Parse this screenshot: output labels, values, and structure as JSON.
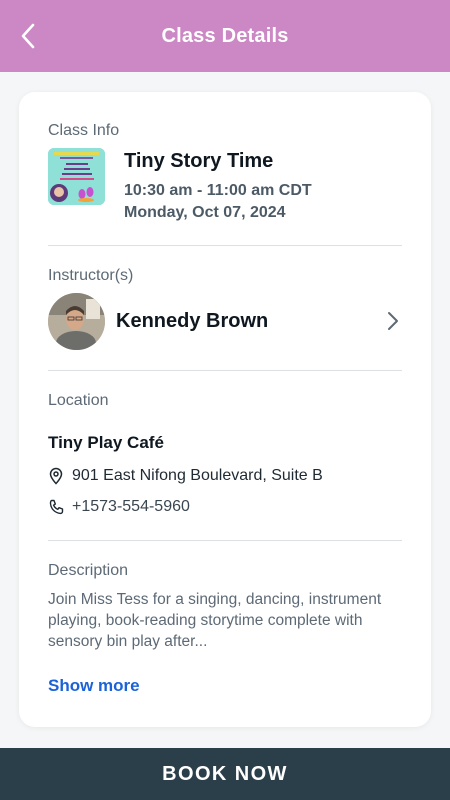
{
  "header": {
    "title": "Class Details",
    "back_icon": "chevron-left-icon",
    "color": "#cc88c4"
  },
  "class_info": {
    "section_label": "Class Info",
    "name": "Tiny Story Time",
    "time": "10:30 am - 11:00 am CDT",
    "date": "Monday, Oct 07, 2024"
  },
  "instructors": {
    "section_label": "Instructor(s)",
    "name": "Kennedy Brown",
    "chevron_icon": "chevron-right-icon"
  },
  "location": {
    "section_label": "Location",
    "name": "Tiny Play Café",
    "address": "901 East Nifong Boulevard, Suite B",
    "address_icon": "map-pin-icon",
    "phone": "+1573-554-5960",
    "phone_icon": "phone-icon"
  },
  "description": {
    "section_label": "Description",
    "text": "Join Miss Tess for a singing, dancing, instrument playing, book-reading storytime complete with sensory bin play after...",
    "show_more_label": "Show more"
  },
  "footer": {
    "book_label": "BOOK NOW",
    "color": "#2b3f4a"
  }
}
